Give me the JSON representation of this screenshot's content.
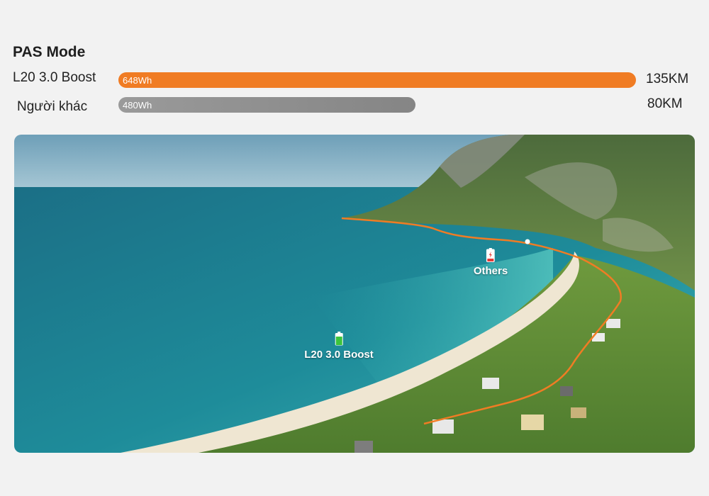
{
  "header": {
    "title": "PAS Mode"
  },
  "comparison": [
    {
      "label": "L20 3.0 Boost",
      "capacity": "648Wh",
      "range": "135KM",
      "range_km": 135,
      "color": "#f07c24"
    },
    {
      "label": "Người khác",
      "capacity": "480Wh",
      "range": "80KM",
      "range_km": 80,
      "color": "#8e8e8e"
    }
  ],
  "scene": {
    "markers": {
      "boost": {
        "label": "L20 3.0 Boost",
        "battery_color": "#3cc43c",
        "icon": "battery-full-icon"
      },
      "others": {
        "label": "Others",
        "battery_color": "#e53935",
        "icon": "battery-low-icon"
      }
    },
    "route_color": "#f07c24"
  }
}
